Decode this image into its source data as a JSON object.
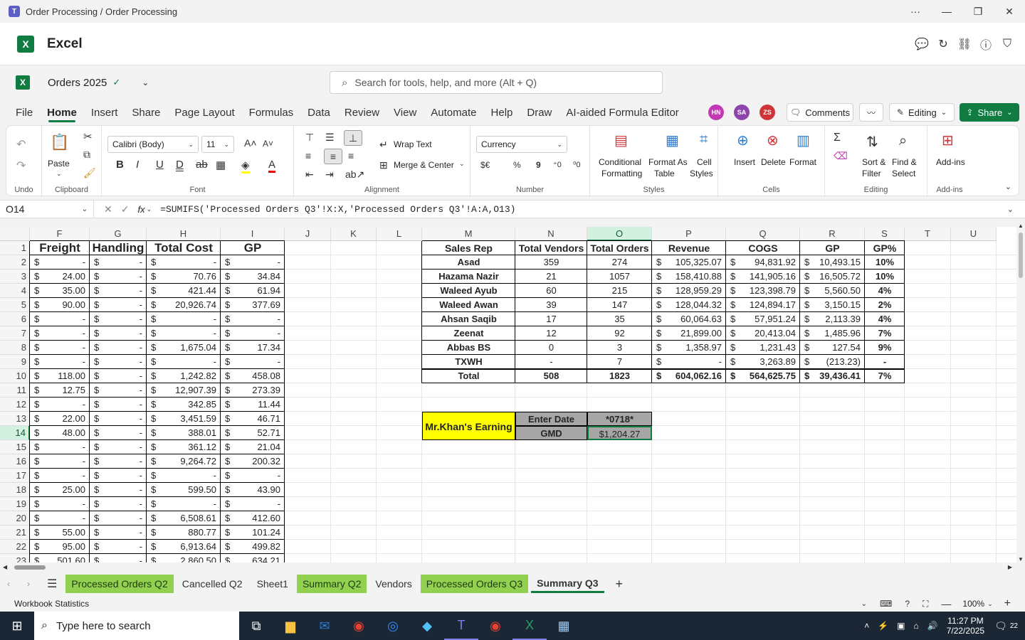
{
  "window": {
    "title": "Order Processing / Order Processing"
  },
  "app": {
    "name": "Excel"
  },
  "file": {
    "name": "Orders 2025"
  },
  "search": {
    "placeholder": "Search for tools, help, and more (Alt + Q)"
  },
  "tabs": [
    "File",
    "Home",
    "Insert",
    "Share",
    "Page Layout",
    "Formulas",
    "Data",
    "Review",
    "View",
    "Automate",
    "Help",
    "Draw",
    "AI-aided Formula Editor"
  ],
  "users": [
    {
      "initials": "HN",
      "color": "#c239b3"
    },
    {
      "initials": "SA",
      "color": "#8e44ad"
    },
    {
      "initials": "ZS",
      "color": "#d13438"
    }
  ],
  "toolbar": {
    "comments": "Comments",
    "editing": "Editing",
    "share": "Share"
  },
  "ribbon": {
    "undo_group": "Undo",
    "clipboard": {
      "label": "Clipboard",
      "paste": "Paste"
    },
    "font": {
      "label": "Font",
      "family": "Calibri (Body)",
      "size": "11"
    },
    "alignment": {
      "label": "Alignment",
      "wrap": "Wrap Text",
      "merge": "Merge & Center"
    },
    "number": {
      "label": "Number",
      "format": "Currency",
      "currency": "$€",
      "percent": "%",
      "comma": "9"
    },
    "styles": {
      "label": "Styles",
      "conditional": "Conditional",
      "conditional2": "Formatting",
      "format_table": "Format As",
      "format_table2": "Table",
      "cell_styles": "Cell",
      "cell_styles2": "Styles"
    },
    "cells": {
      "label": "Cells",
      "insert": "Insert",
      "delete": "Delete",
      "format": "Format"
    },
    "editing": {
      "label": "Editing",
      "sort": "Sort &",
      "sort2": "Filter",
      "find": "Find &",
      "find2": "Select"
    },
    "addins": {
      "label": "Add-ins",
      "addins": "Add-ins"
    }
  },
  "formula_bar": {
    "namebox": "O14",
    "fx": "fx",
    "formula": "=SUMIFS('Processed Orders Q3'!X:X,'Processed Orders Q3'!A:A,O13)"
  },
  "columns": [
    "F",
    "G",
    "H",
    "I",
    "J",
    "K",
    "L",
    "M",
    "N",
    "O",
    "P",
    "Q",
    "R",
    "S",
    "T",
    "U"
  ],
  "rows": [
    "1",
    "2",
    "3",
    "4",
    "5",
    "6",
    "7",
    "8",
    "9",
    "10",
    "11",
    "12",
    "13",
    "14",
    "15",
    "16",
    "17",
    "18",
    "19",
    "20",
    "21",
    "22",
    "23"
  ],
  "left_table": {
    "headers": [
      "Freight",
      "Handling",
      "Total Cost",
      "GP"
    ],
    "rows": [
      [
        "-",
        "-",
        "-",
        "-"
      ],
      [
        "24.00",
        "-",
        "70.76",
        "34.84"
      ],
      [
        "35.00",
        "-",
        "421.44",
        "61.94"
      ],
      [
        "90.00",
        "-",
        "20,926.74",
        "377.69"
      ],
      [
        "-",
        "-",
        "-",
        "-"
      ],
      [
        "-",
        "-",
        "-",
        "-"
      ],
      [
        "-",
        "-",
        "1,675.04",
        "17.34"
      ],
      [
        "-",
        "-",
        "-",
        "-"
      ],
      [
        "118.00",
        "-",
        "1,242.82",
        "458.08"
      ],
      [
        "12.75",
        "-",
        "12,907.39",
        "273.39"
      ],
      [
        "-",
        "-",
        "342.85",
        "11.44"
      ],
      [
        "22.00",
        "-",
        "3,451.59",
        "46.71"
      ],
      [
        "48.00",
        "-",
        "388.01",
        "52.71"
      ],
      [
        "-",
        "-",
        "361.12",
        "21.04"
      ],
      [
        "-",
        "-",
        "9,264.72",
        "200.32"
      ],
      [
        "-",
        "-",
        "-",
        "-"
      ],
      [
        "25.00",
        "-",
        "599.50",
        "43.90"
      ],
      [
        "-",
        "-",
        "-",
        "-"
      ],
      [
        "-",
        "-",
        "6,508.61",
        "412.60"
      ],
      [
        "55.00",
        "-",
        "880.77",
        "101.24"
      ],
      [
        "95.00",
        "-",
        "6,913.64",
        "499.82"
      ],
      [
        "501.60",
        "-",
        "2,860.50",
        "634.21"
      ]
    ]
  },
  "summary_table": {
    "headers": [
      "Sales Rep",
      "Total Vendors",
      "Total Orders",
      "Revenue",
      "COGS",
      "GP",
      "GP%"
    ],
    "rows": [
      [
        "Asad",
        "359",
        "274",
        "105,325.07",
        "94,831.92",
        "10,493.15",
        "10%"
      ],
      [
        "Hazama Nazir",
        "21",
        "1057",
        "158,410.88",
        "141,905.16",
        "16,505.72",
        "10%"
      ],
      [
        "Waleed Ayub",
        "60",
        "215",
        "128,959.29",
        "123,398.79",
        "5,560.50",
        "4%"
      ],
      [
        "Waleed Awan",
        "39",
        "147",
        "128,044.32",
        "124,894.17",
        "3,150.15",
        "2%"
      ],
      [
        "Ahsan Saqib",
        "17",
        "35",
        "60,064.63",
        "57,951.24",
        "2,113.39",
        "4%"
      ],
      [
        "Zeenat",
        "12",
        "92",
        "21,899.00",
        "20,413.04",
        "1,485.96",
        "7%"
      ],
      [
        "Abbas BS",
        "0",
        "3",
        "1,358.97",
        "1,231.43",
        "127.54",
        "9%"
      ],
      [
        "TXWH",
        "-",
        "7",
        "-",
        "3,263.89",
        "(213.23)",
        "-"
      ],
      [
        "Total",
        "508",
        "1823",
        "604,062.16",
        "564,625.75",
        "39,436.41",
        "7%"
      ]
    ],
    "currency_symbol": "$"
  },
  "earning": {
    "title": "Mr.Khan's Earning",
    "enter_date": "Enter Date",
    "date_value": "*0718*",
    "gmd": "GMD",
    "gmd_value": "$1,204.27"
  },
  "sheet_tabs": [
    {
      "name": "Processed Orders Q2",
      "color": "green"
    },
    {
      "name": "Cancelled Q2",
      "color": "none"
    },
    {
      "name": "Sheet1",
      "color": "none"
    },
    {
      "name": "Summary Q2",
      "color": "green"
    },
    {
      "name": "Vendors",
      "color": "none"
    },
    {
      "name": "Processed Orders Q3",
      "color": "green"
    },
    {
      "name": "Summary Q3",
      "color": "active"
    }
  ],
  "status": {
    "left": "Workbook Statistics",
    "zoom": "100%"
  },
  "taskbar": {
    "search": "Type here to search",
    "time": "11:27 PM",
    "date": "7/22/2025",
    "notif": "22"
  }
}
